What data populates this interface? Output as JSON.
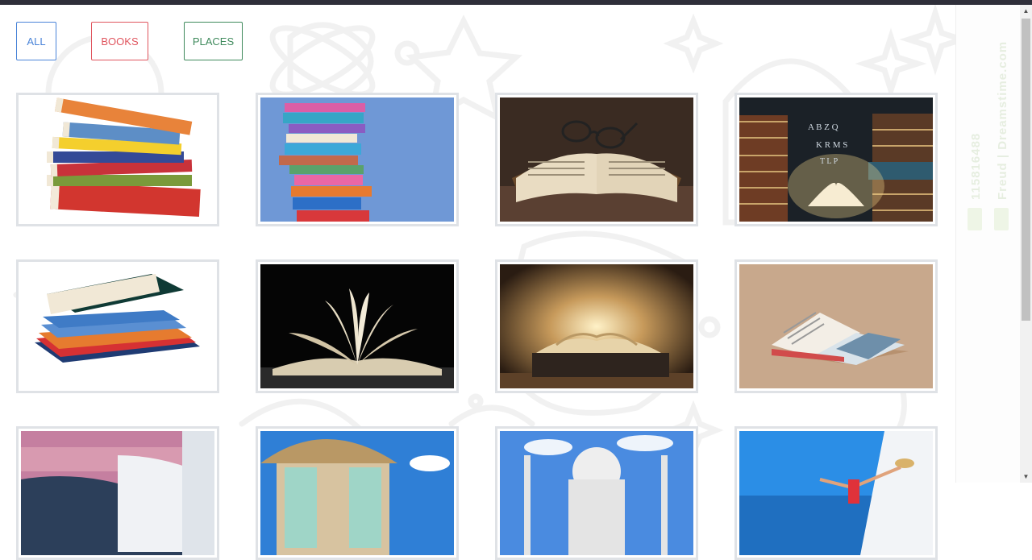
{
  "filters": {
    "all_label": "ALL",
    "books_label": "BOOKS",
    "places_label": "PLACES"
  },
  "watermark": {
    "id_text": "115816488",
    "site_text": "Freud | Dreamstime.com"
  },
  "gallery": {
    "items": [
      {
        "category": "books",
        "subject": "stack of colorful books"
      },
      {
        "category": "books",
        "subject": "tall stack of books on blue background"
      },
      {
        "category": "books",
        "subject": "open book with glasses"
      },
      {
        "category": "books",
        "subject": "magic glowing book with letters"
      },
      {
        "category": "books",
        "subject": "stack of hardcover books"
      },
      {
        "category": "books",
        "subject": "open book on black background"
      },
      {
        "category": "books",
        "subject": "glowing old book"
      },
      {
        "category": "books",
        "subject": "open magazine on beige background"
      },
      {
        "category": "places",
        "subject": "Santorini cliffs at sunset"
      },
      {
        "category": "places",
        "subject": "thatched beach hut"
      },
      {
        "category": "places",
        "subject": "Taj Mahal"
      },
      {
        "category": "places",
        "subject": "woman with hat at seaside village"
      }
    ]
  }
}
